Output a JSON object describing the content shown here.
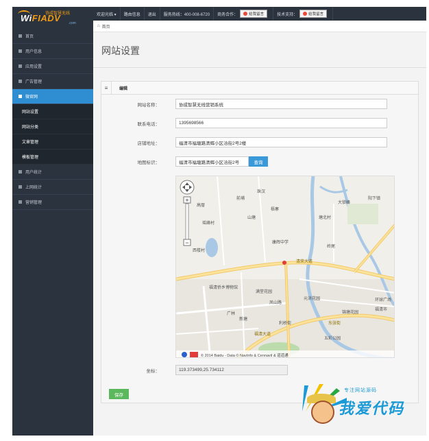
{
  "logo": {
    "brand_part1": "Wi",
    "brand_part2": "FIADV",
    "tagline": "协成智慧无线",
    "domain": ".com"
  },
  "topnav": {
    "items": [
      "欢迎光临 ▾",
      "路由信息",
      "退出",
      "服务热线：400-008-6720",
      "商务合作：",
      "技术支持："
    ],
    "qq_label": "给我留言"
  },
  "sidebar": {
    "items": [
      {
        "label": "首页"
      },
      {
        "label": "用户信息"
      },
      {
        "label": "应用设置"
      },
      {
        "label": "广告管理"
      },
      {
        "label": "微官网"
      }
    ],
    "sub_items": [
      {
        "label": "网站设置"
      },
      {
        "label": "网站分类"
      },
      {
        "label": "文章管理"
      },
      {
        "label": "模板管理"
      }
    ],
    "bottom_items": [
      {
        "label": "用户统计"
      },
      {
        "label": "上网统计"
      },
      {
        "label": "营销管理"
      }
    ]
  },
  "breadcrumb": {
    "text": "首页"
  },
  "page": {
    "title": "网站设置"
  },
  "panel": {
    "title": "编辑"
  },
  "form": {
    "site_name_label": "网站名称：",
    "site_name_value": "协成智慧无线营销系统",
    "phone_label": "联系电话：",
    "phone_value": "1395698566",
    "address_label": "店铺地址：",
    "address_value": "福清市福塘路清辉小区洽街2号2楼",
    "map_label": "地图标识：",
    "map_value": "福清市福塘路清辉小区洽街2号",
    "query_button": "查询",
    "coord_label": "坐标：",
    "coord_value": "119.373499,25.734112",
    "save_button": "保存"
  },
  "map": {
    "labels": [
      "珠汉",
      "前埔",
      "高厝",
      "瑶峰村",
      "山塘",
      "梧寨",
      "塘北村",
      "西楼村",
      "康辉中学",
      "岭尾",
      "大锁峰",
      "阳下镇",
      "清荣大道",
      "福清侨乡博物馆",
      "满堂花园",
      "凤山路",
      "元洪花园",
      "锦塘花园",
      "环球广场",
      "福清市",
      "广林",
      "新塘",
      "五彩公园",
      "利桥街",
      "福清大道",
      "东张街"
    ],
    "credit": "© 2014 Baidu - Data © NavInfo & CennaviI & 道道通"
  },
  "watermark": {
    "line1": "专注网站源码",
    "line2": "我爱代码"
  }
}
